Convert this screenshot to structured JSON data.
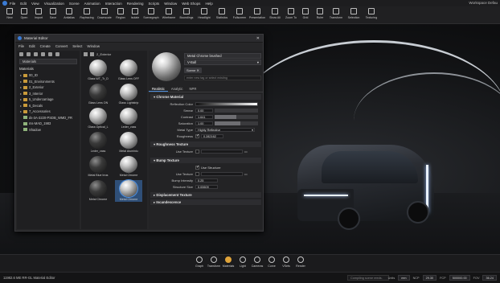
{
  "menubar": {
    "items": [
      "File",
      "Edit",
      "View",
      "Visualization",
      "Scene",
      "Animation",
      "Interaction",
      "Rendering",
      "Scripts",
      "Window",
      "Web Shops",
      "Help"
    ],
    "workspace": "Workspace Defau"
  },
  "toolbar": {
    "items": [
      {
        "label": "New",
        "icon": "new-icon"
      },
      {
        "label": "Open",
        "icon": "open-icon"
      },
      {
        "label": "Import",
        "icon": "import-icon"
      },
      {
        "label": "Save",
        "icon": "save-icon"
      },
      {
        "label": "Antialias",
        "icon": "antialias-icon"
      },
      {
        "label": "Raytracing",
        "icon": "raytracing-icon"
      },
      {
        "label": "Downscale",
        "icon": "downscale-icon"
      },
      {
        "label": "Region",
        "icon": "region-icon"
      },
      {
        "label": "Isolate",
        "icon": "isolate-icon"
      },
      {
        "label": "Scenegraph",
        "icon": "scenegraph-icon"
      },
      {
        "label": "Wireframe",
        "icon": "wireframe-icon"
      },
      {
        "label": "Boundings",
        "icon": "boundings-icon"
      },
      {
        "label": "Headlight",
        "icon": "headlight-icon"
      },
      {
        "label": "Statistics",
        "icon": "statistics-icon"
      },
      {
        "label": "Fullscreen",
        "icon": "fullscreen-icon"
      },
      {
        "label": "Presentation",
        "icon": "presentation-icon"
      },
      {
        "label": "Show All",
        "icon": "show-all-icon"
      },
      {
        "label": "Zoom To",
        "icon": "zoom-to-icon"
      },
      {
        "label": "Grid",
        "icon": "grid-icon"
      },
      {
        "label": "Ruler",
        "icon": "ruler-icon"
      },
      {
        "label": "Transform",
        "icon": "transform-icon"
      },
      {
        "label": "Selection",
        "icon": "selection-icon"
      },
      {
        "label": "Texturing",
        "icon": "texturing-icon"
      }
    ]
  },
  "material_editor": {
    "title": "Material Editor",
    "menus": [
      "File",
      "Edit",
      "Create",
      "Convert",
      "Select",
      "Window"
    ],
    "tree": {
      "filter": "Materials",
      "root": "Materials",
      "items": [
        {
          "label": "00_ID",
          "type": "folder"
        },
        {
          "label": "01_Environments",
          "type": "folder"
        },
        {
          "label": "2_Exterior",
          "type": "folder"
        },
        {
          "label": "3_Interior",
          "type": "folder"
        },
        {
          "label": "5_Undercarriage",
          "type": "folder"
        },
        {
          "label": "6_Decals",
          "type": "folder"
        },
        {
          "label": "7_Accessories",
          "type": "folder"
        },
        {
          "label": "ds-3A-3220-PSDB_WMD_FR",
          "type": "switch"
        },
        {
          "label": "ms-MAD_1983",
          "type": "switch"
        },
        {
          "label": "Shadow",
          "type": "switch"
        }
      ]
    },
    "grid": {
      "path": "2_Exterior",
      "thumbs": [
        {
          "label": "Glass WT_Tr_D",
          "dark": false
        },
        {
          "label": "Glass Lens OFF",
          "dark": false
        },
        {
          "label": "Glass Lens ON",
          "dark": true
        },
        {
          "label": "Glass Lightstrip",
          "dark": false
        },
        {
          "label": "Glass Optical_L",
          "dark": false
        },
        {
          "label": "Leder_vass",
          "dark": false
        },
        {
          "label": "Leder_vass",
          "dark": true
        },
        {
          "label": "Metal Aluminiu",
          "dark": false
        },
        {
          "label": "Metal Blue brus",
          "dark": true
        },
        {
          "label": "Metal Chrome",
          "dark": false
        },
        {
          "label": "Metal Chrome",
          "dark": true
        },
        {
          "label": "Metal Chrome",
          "dark": false
        }
      ]
    },
    "props": {
      "name": "Metal Chrome brushed",
      "renderer": "V-Ball",
      "scene_tag": "Scene",
      "tag_placeholder": "enter new tag or select existing",
      "tabs": [
        "Realistic",
        "Analytic",
        "NPR"
      ],
      "chrome_section": "Chrome Material",
      "reflection_color_label": "Reflection Color",
      "rows": [
        {
          "label": "Smear",
          "value": "0.00",
          "fill": 0.0
        },
        {
          "label": "Contrast",
          "value": "1.641",
          "fill": 0.5
        },
        {
          "label": "Saturation",
          "value": "1.00",
          "fill": 0.6
        }
      ],
      "metal_type_label": "Metal Type",
      "metal_type": "Highly Reflective",
      "roughness_label": "Roughness",
      "roughness": "0.282162",
      "roughness_texture_section": "Roughness Texture",
      "use_texture_label": "Use Texture",
      "bump_section": "Bump Texture",
      "use_structure_label": "Use Structure",
      "bump_use_texture_label": "Use Texture",
      "bump_intensity_label": "Bump Intensity",
      "bump_intensity": "0.25",
      "structure_size_label": "Structure Size",
      "structure_size": "0.00609",
      "displacement_section": "Displacement Texture",
      "incandescence_section": "Incandescence"
    }
  },
  "dock": {
    "items": [
      {
        "label": "Graph",
        "icon": "graph-icon"
      },
      {
        "label": "Transform",
        "icon": "transform-icon"
      },
      {
        "label": "Materials",
        "icon": "materials-icon",
        "active": true
      },
      {
        "label": "Light",
        "icon": "light-icon"
      },
      {
        "label": "Cameras",
        "icon": "cameras-icon"
      },
      {
        "label": "Curve",
        "icon": "curve-icon"
      },
      {
        "label": "VSets",
        "icon": "vsets-icon"
      },
      {
        "label": "Render",
        "icon": "render-icon"
      }
    ]
  },
  "status": {
    "left": "11982.6 ME  RR-GL  Material Editor",
    "message": "Compiling scene reeds.",
    "units_label": "Units",
    "units": "mm",
    "ncp_label": "NCP",
    "ncp": "29.30",
    "fcp_label": "FCP",
    "fcp": "500000.00",
    "fov_label": "FOV",
    "fov": "36.24"
  }
}
